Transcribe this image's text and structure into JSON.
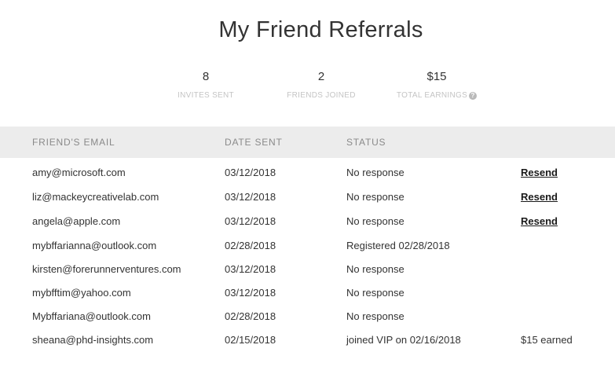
{
  "page": {
    "title": "My Friend Referrals"
  },
  "stats": [
    {
      "value": "8",
      "label": "INVITES SENT"
    },
    {
      "value": "2",
      "label": "FRIENDS JOINED"
    },
    {
      "value": "$15",
      "label": "TOTAL EARNINGS",
      "icon": "help-icon"
    }
  ],
  "table": {
    "headers": {
      "email": "FRIEND'S EMAIL",
      "date": "DATE SENT",
      "status": "STATUS"
    },
    "rows": [
      {
        "email": "amy@microsoft.com",
        "date": "03/12/2018",
        "status": "No response",
        "action": "Resend"
      },
      {
        "email": "liz@mackeycreativelab.com",
        "date": "03/12/2018",
        "status": "No response",
        "action": "Resend"
      },
      {
        "email": "angela@apple.com",
        "date": "03/12/2018",
        "status": "No response",
        "action": "Resend"
      },
      {
        "email": "mybffarianna@outlook.com",
        "date": "02/28/2018",
        "status": "Registered 02/28/2018",
        "action": ""
      },
      {
        "email": "kirsten@forerunnerventures.com",
        "date": "03/12/2018",
        "status": "No response",
        "action": ""
      },
      {
        "email": "mybfftim@yahoo.com",
        "date": "03/12/2018",
        "status": "No response",
        "action": ""
      },
      {
        "email": "Mybffariana@outlook.com",
        "date": "02/28/2018",
        "status": "No response",
        "action": ""
      },
      {
        "email": "sheana@phd-insights.com",
        "date": "02/15/2018",
        "status": "joined VIP on 02/16/2018",
        "action": "$15 earned"
      }
    ]
  }
}
